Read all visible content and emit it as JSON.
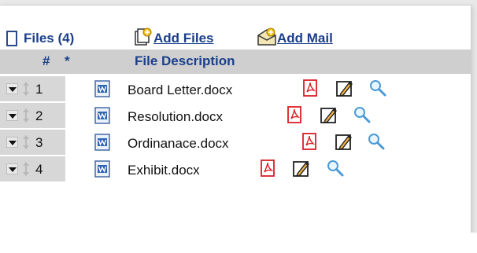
{
  "toolbar": {
    "files_label": "Files (4)",
    "add_files_label": "Add Files",
    "add_mail_label": "Add Mail"
  },
  "table": {
    "headers": {
      "number": "#",
      "star": "*",
      "description": "File Description"
    },
    "rows": [
      {
        "number": "1",
        "file_name": "Board Letter.docx"
      },
      {
        "number": "2",
        "file_name": "Resolution.docx"
      },
      {
        "number": "3",
        "file_name": "Ordinanace.docx"
      },
      {
        "number": "4",
        "file_name": "Exhibit.docx"
      }
    ]
  },
  "icons": {
    "files_icon": "document-icon",
    "add_files_icon": "add-files-icon",
    "add_mail_icon": "add-mail-icon",
    "row_actions": [
      "pdf-icon",
      "edit-icon",
      "search-icon"
    ]
  },
  "colors": {
    "link": "#1b3f8a",
    "header_bg": "#cfcfcf",
    "control_bg": "#d7d7d7",
    "pdf_red": "#d81f26"
  }
}
